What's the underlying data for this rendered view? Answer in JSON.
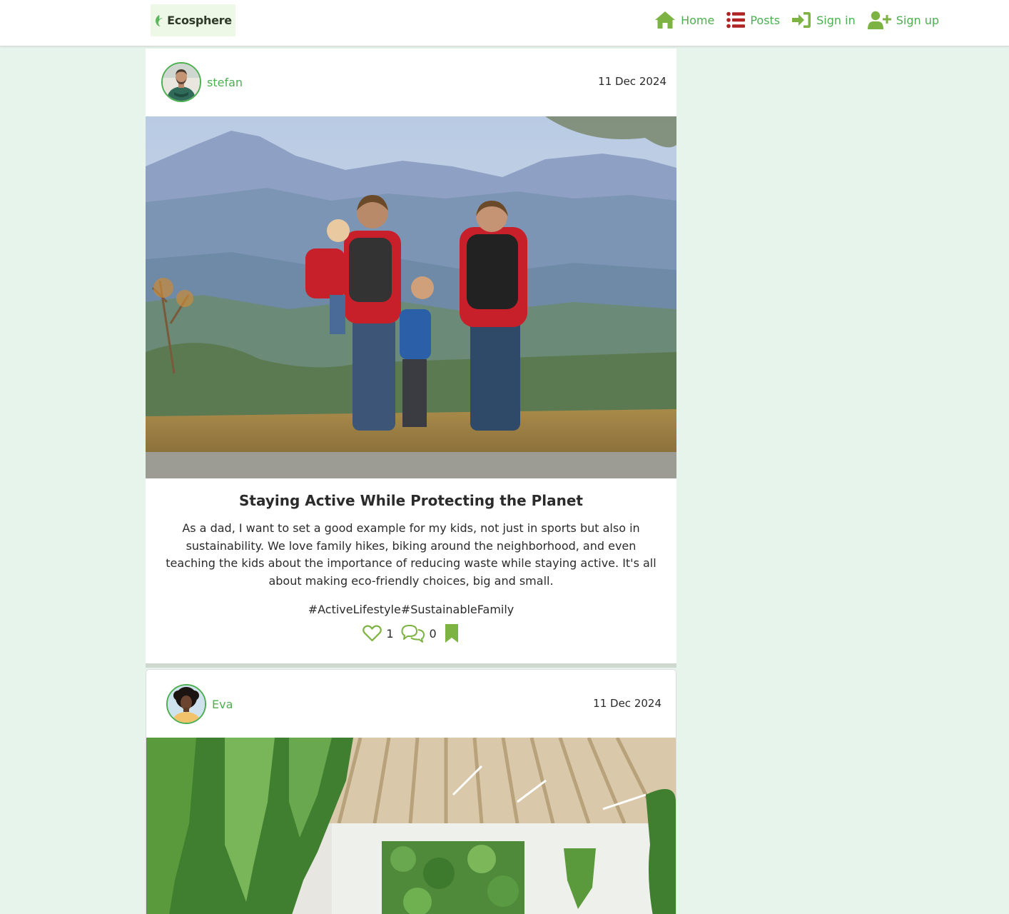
{
  "navbar": {
    "logo_text": "Ecosphere",
    "links": [
      {
        "label": "Home",
        "icon": "home-icon"
      },
      {
        "label": "Posts",
        "icon": "list-icon"
      },
      {
        "label": "Sign in",
        "icon": "sign-in-icon"
      },
      {
        "label": "Sign up",
        "icon": "user-plus-icon"
      }
    ]
  },
  "posts": [
    {
      "author": "stefan",
      "date": "11 Dec 2024",
      "image": "family-hiking-mountains-photo",
      "title": "Staying Active While Protecting the Planet",
      "body": "As a dad, I want to set a good example for my kids, not just in sports but also in sustainability. We love family hikes, biking around the neighborhood, and even teaching the kids about the importance of reducing waste while staying active. It's all about making eco-friendly choices, big and small.",
      "tags": "#ActiveLifestyle#SustainableFamily",
      "likes": "1",
      "comments": "0"
    },
    {
      "author": "Eva",
      "date": "11 Dec 2024",
      "image": "green-office-plant-wall-photo"
    }
  ],
  "colors": {
    "accent": "#4caf50",
    "nav_icon_green": "#7cb342",
    "nav_icon_red": "#b22222",
    "page_background": "#e6f4ec"
  }
}
